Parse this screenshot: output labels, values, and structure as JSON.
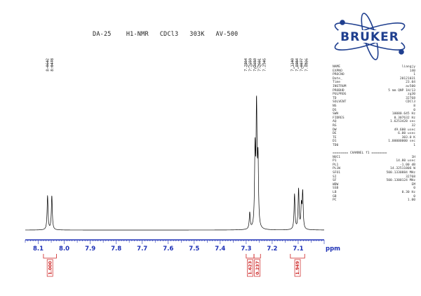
{
  "header": {
    "title": "DA-25    H1-NMR   CDCl3   303K   AV-500"
  },
  "logo": {
    "text": "BRUKER",
    "color": "#1f3f8f"
  },
  "params": [
    {
      "k": "NAME",
      "v": "liangjy"
    },
    {
      "k": "EXPNO",
      "v": "140"
    },
    {
      "k": "PROCNO",
      "v": "1"
    },
    {
      "k": "Date_",
      "v": "20121031"
    },
    {
      "k": "Time",
      "v": "23.04"
    },
    {
      "k": "INSTRUM",
      "v": "av500"
    },
    {
      "k": "PROBHD",
      "v": "5 mm QNP 1H/13"
    },
    {
      "k": "PULPROG",
      "v": "zg30"
    },
    {
      "k": "TD",
      "v": "32768"
    },
    {
      "k": "SOLVENT",
      "v": "CDCl3"
    },
    {
      "k": "NS",
      "v": "8"
    },
    {
      "k": "DS",
      "v": "0"
    },
    {
      "k": "SWH",
      "v": "10080.645 Hz"
    },
    {
      "k": "FIDRES",
      "v": "0.307632 Hz"
    },
    {
      "k": "AQ",
      "v": "1.6253428 sec"
    },
    {
      "k": "RG",
      "v": "32"
    },
    {
      "k": "DW",
      "v": "49.600 usec"
    },
    {
      "k": "DE",
      "v": "6.00 usec"
    },
    {
      "k": "TE",
      "v": "303.0 K"
    },
    {
      "k": "D1",
      "v": "1.00000000 sec"
    },
    {
      "k": "TD0",
      "v": "1"
    },
    {
      "gap": true
    },
    {
      "head": "======== CHANNEL f1 ========"
    },
    {
      "k": "NUC1",
      "v": "1H"
    },
    {
      "k": "P1",
      "v": "14.80 usec"
    },
    {
      "k": "PL1",
      "v": "-1.00 dB"
    },
    {
      "k": "PL1W",
      "v": "14.32511806 W"
    },
    {
      "k": "SFO1",
      "v": "500.1330884 MHz"
    },
    {
      "k": "SI",
      "v": "32768"
    },
    {
      "k": "SF",
      "v": "500.1300124 MHz"
    },
    {
      "k": "WDW",
      "v": "EM"
    },
    {
      "k": "SSB",
      "v": "0"
    },
    {
      "k": "LB",
      "v": "0.30 Hz"
    },
    {
      "k": "GB",
      "v": "0"
    },
    {
      "k": "PC",
      "v": "1.00"
    }
  ],
  "chart_data": {
    "type": "line",
    "xlabel": "ppm",
    "xlim": [
      8.15,
      7.0
    ],
    "x_reversed": true,
    "ticks": [
      8.1,
      8.0,
      7.9,
      7.8,
      7.7,
      7.6,
      7.5,
      7.4,
      7.3,
      7.2,
      7.1
    ],
    "tick_labels": [
      "8.1",
      "8.0",
      "7.9",
      "7.8",
      "7.7",
      "7.6",
      "7.5",
      "7.4",
      "7.3",
      "7.2",
      "7.1"
    ],
    "peak_labels": [
      "8.0642",
      "8.0478",
      "7.2864",
      "7.2659",
      "7.2650",
      "7.2601",
      "7.2545",
      "7.1140",
      "7.0984",
      "7.0877",
      "7.0826"
    ],
    "peaks": [
      {
        "ppm": 8.0642,
        "height": 0.29
      },
      {
        "ppm": 8.0478,
        "height": 0.29
      },
      {
        "ppm": 7.2864,
        "height": 0.14
      },
      {
        "ppm": 7.2659,
        "height": 0.64
      },
      {
        "ppm": 7.2601,
        "height": 1.0
      },
      {
        "ppm": 7.2545,
        "height": 0.55
      },
      {
        "ppm": 7.114,
        "height": 0.3
      },
      {
        "ppm": 7.0984,
        "height": 0.34
      },
      {
        "ppm": 7.0877,
        "height": 0.19
      },
      {
        "ppm": 7.0826,
        "height": 0.31
      }
    ],
    "integrals": [
      {
        "from": 8.08,
        "to": 8.03,
        "value": "1.000"
      },
      {
        "from": 7.3,
        "to": 7.27,
        "value": "1.623"
      },
      {
        "from": 7.27,
        "to": 7.245,
        "value": "0.237"
      },
      {
        "from": 7.13,
        "to": 7.075,
        "value": "1.949"
      }
    ],
    "colors": {
      "spectrum": "#000000",
      "axis": "#1c2fb5",
      "integral": "#cc2020"
    }
  }
}
